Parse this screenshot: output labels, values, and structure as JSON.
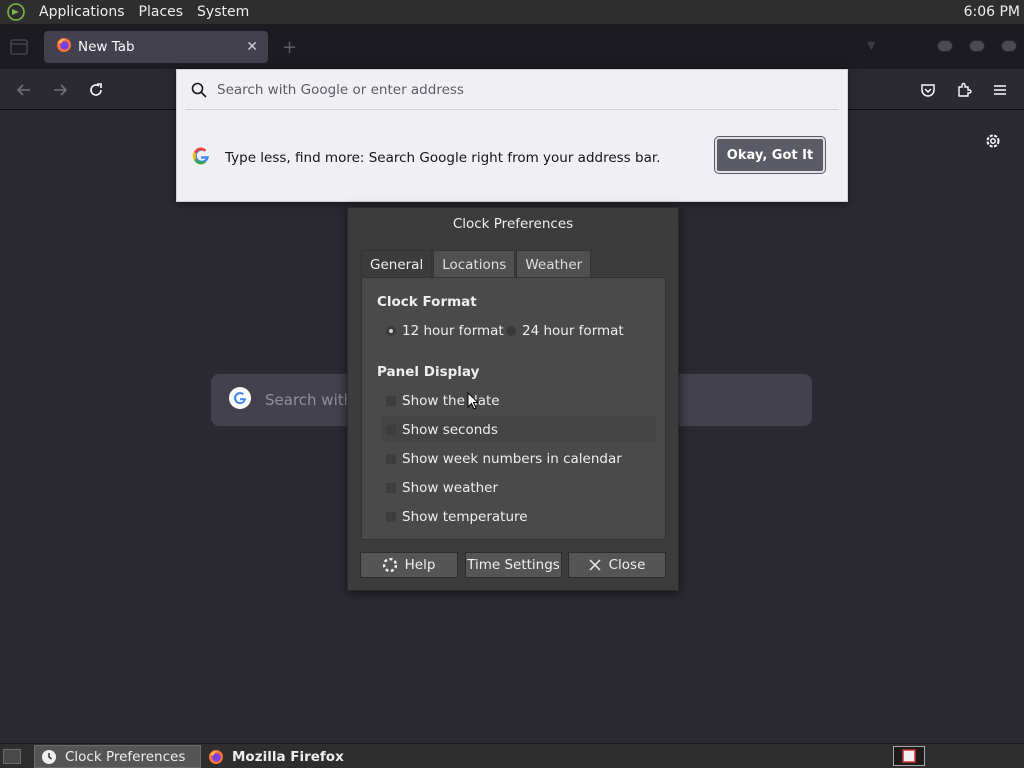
{
  "top_panel": {
    "menus": [
      "Applications",
      "Places",
      "System"
    ],
    "clock": "6:06 PM"
  },
  "browser": {
    "tab_title": "New Tab",
    "address_placeholder": "Search with Google or enter address",
    "tip_text": "Type less, find more: Search Google right from your address bar.",
    "tip_button": "Okay, Got It",
    "ntp_search_placeholder": "Search with"
  },
  "dialog": {
    "title": "Clock Preferences",
    "tabs": [
      "General",
      "Locations",
      "Weather"
    ],
    "active_tab": "General",
    "clock_format": {
      "heading": "Clock Format",
      "options": [
        "12 hour format",
        "24 hour format"
      ],
      "selected": "12 hour format"
    },
    "panel_display": {
      "heading": "Panel Display",
      "options": [
        "Show the date",
        "Show seconds",
        "Show week numbers in calendar",
        "Show weather",
        "Show temperature"
      ]
    },
    "buttons": {
      "help": "Help",
      "time_settings": "Time Settings",
      "close": "Close"
    }
  },
  "taskbar": {
    "tasks": [
      "Clock Preferences",
      "Mozilla Firefox"
    ]
  },
  "colors": {
    "browser_bg": "#2b2a33",
    "popup_bg": "#f0f0f4",
    "dialog_bg": "#3c3c3c",
    "panel_bg": "#2e2e2e"
  }
}
